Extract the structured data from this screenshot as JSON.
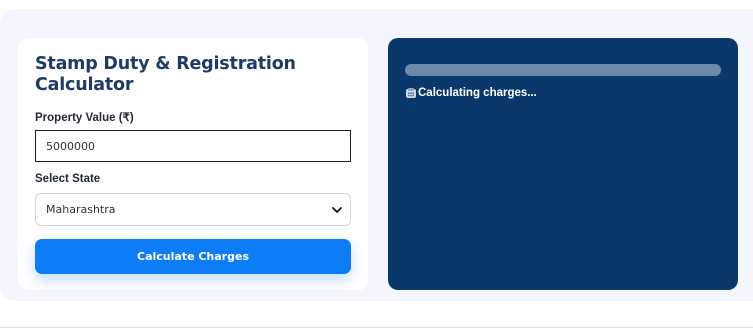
{
  "calculator": {
    "title": "Stamp Duty & Registration Calculator",
    "property_value_label": "Property Value (₹)",
    "property_value": "5000000",
    "state_label": "Select State",
    "state_selected": "Maharashtra",
    "calculate_label": "Calculate Charges"
  },
  "result": {
    "status_text": "Calculating charges...",
    "status_icon": "calculator-icon"
  },
  "colors": {
    "accent": "#0d7cf7",
    "result_panel": "#0b386b",
    "title": "#1f3a63"
  }
}
